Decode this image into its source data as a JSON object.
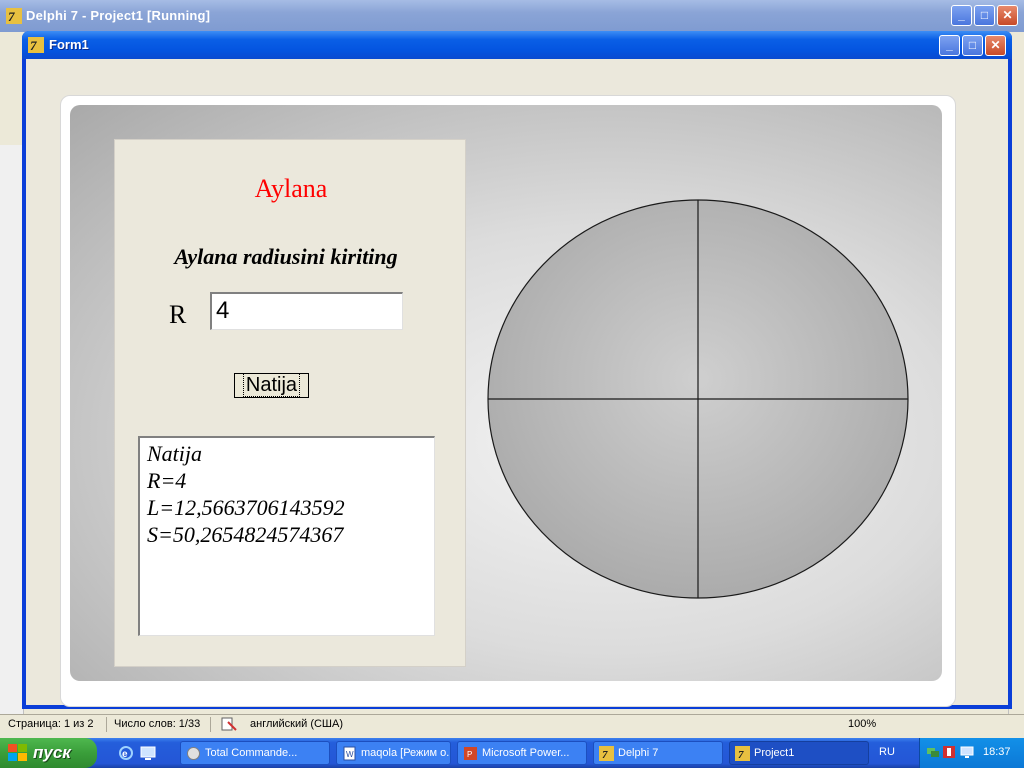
{
  "ide": {
    "title": "Delphi 7 - Project1 [Running]"
  },
  "form": {
    "title": "Form1",
    "heading": "Aylana",
    "prompt": "Aylana radiusini kiriting",
    "r_label": "R",
    "r_value": "4",
    "button_label": "Natija",
    "result_lines": [
      "Natija",
      "R=4",
      "L=12,5663706143592",
      "S=50,2654824574367"
    ]
  },
  "statusbar": {
    "page": "Страница: 1 из 2",
    "words": "Число слов: 1/33",
    "language": "английский (США)",
    "zoom": "100%"
  },
  "taskbar": {
    "start_label": "пуск",
    "tasks": [
      "Total Commande...",
      "maqola [Режим о...",
      "Microsoft Power...",
      "Delphi 7",
      "Project1"
    ],
    "language": "RU",
    "clock": "18:37"
  },
  "colors": {
    "heading": "#ff0000",
    "title_bar": "#0a5fe6",
    "start_button": "#3a9e3a"
  }
}
